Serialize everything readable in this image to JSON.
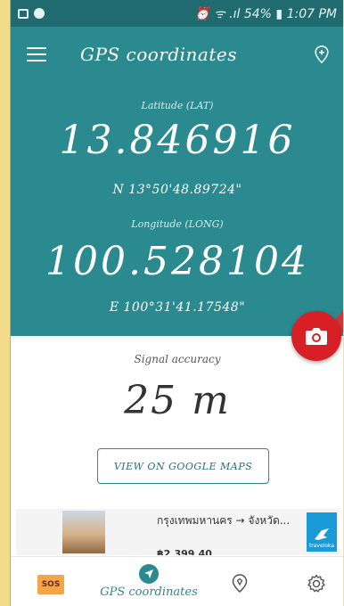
{
  "status_bar": {
    "text": "⏰ ᯤ .ıl 54% ▮ 1:07 PM"
  },
  "app_bar": {
    "title": "GPS coordinates",
    "menu_icon": "hamburger-menu-icon",
    "action_icon": "add-location-icon"
  },
  "latitude": {
    "label": "Latitude (LAT)",
    "value": "13.846916",
    "dms": "N 13°50'48.89724\""
  },
  "longitude": {
    "label": "Longitude (LONG)",
    "value": "100.528104",
    "dms": "E 100°31'41.17548\""
  },
  "signal": {
    "label": "Signal accuracy",
    "value": "25 m"
  },
  "maps_button": {
    "label": "VIEW ON GOOGLE MAPS"
  },
  "ad": {
    "text": "กรุงเทพมหานคร → จังหวัด...",
    "price": "฿2,399.40",
    "brand": "traveloka"
  },
  "bottom_nav": {
    "sos_label": "SOS",
    "gps_label": "GPS coordinates"
  },
  "colors": {
    "primary": "#2a8a8f",
    "fab": "#d81f26",
    "status": "#1f6b6f"
  }
}
